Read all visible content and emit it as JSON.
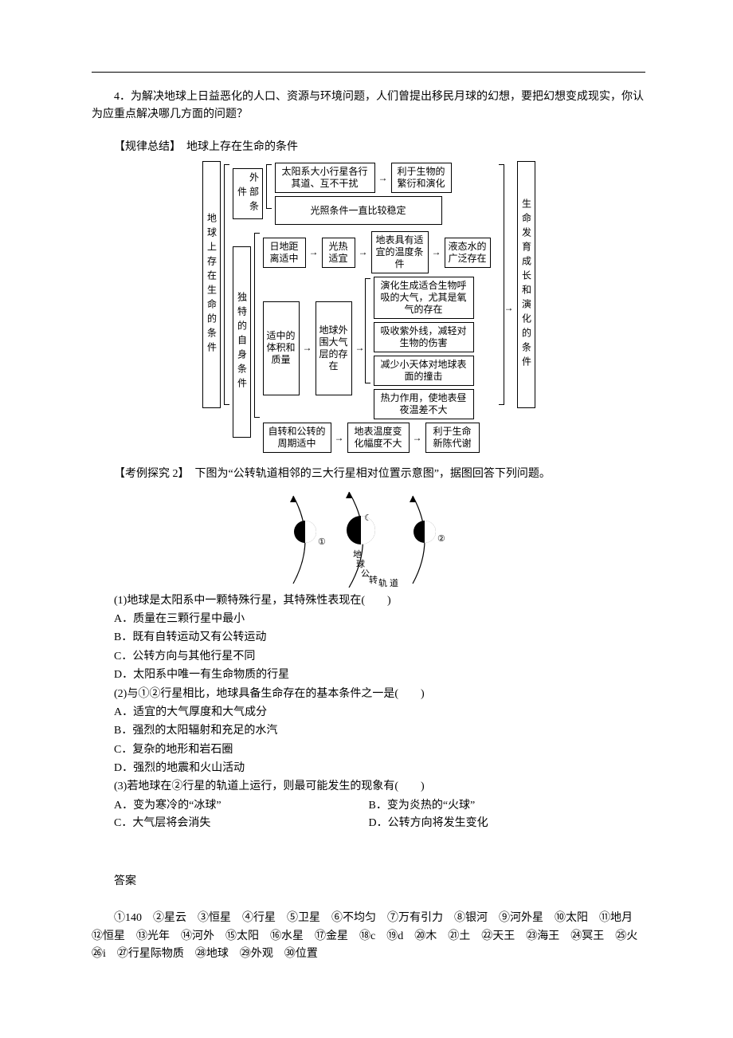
{
  "q4": {
    "label": "4．",
    "text": "为解决地球上日益恶化的人口、资源与环境问题，人们曾提出移民月球的幻想，要把幻想变成现实，你认为应重点解决哪几方面的问题？"
  },
  "rule_summary": {
    "label": "【规律总结】",
    "title": "地球上存在生命的条件"
  },
  "diagram": {
    "main": "地球上存在生命的条件",
    "external_label": "外部条件",
    "ext1": "太阳系大小行星各行其道、互不干扰",
    "ext1r": "利于生物的繁衍和演化",
    "ext2": "光照条件一直比较稳定",
    "self_label": "独特的自身条件",
    "s1a": "日地距离适中",
    "s1b": "光热适宜",
    "s1c": "地表具有适宜的温度条件",
    "s1d": "液态水的广泛存在",
    "s2a": "适中的体积和质量",
    "s2b": "地球外围大气层的存在",
    "s2c1": "演化生成适合生物呼吸的大气，尤其是氧气的存在",
    "s2c2": "吸收紫外线，减轻对生物的伤害",
    "s2c3": "减少小天体对地球表面的撞击",
    "s2c4": "热力作用，使地表昼夜温差不大",
    "s3a": "自转和公转的周期适中",
    "s3b": "地表温度变化幅度不大",
    "s3c": "利于生命新陈代谢",
    "right": "生命发育成长和演化的条件"
  },
  "ex2": {
    "label": "【考例探究 2】",
    "intro": "下图为“公转轨道相邻的三大行星相对位置示意图”，据图回答下列问题。",
    "fig": {
      "label1": "①",
      "earth": "地球",
      "orbit": "公转轨道",
      "label2": "②"
    },
    "q1": {
      "stem": "(1)地球是太阳系中一颗特殊行星，其特殊性表现在(　　)",
      "A": "A．质量在三颗行星中最小",
      "B": "B．既有自转运动又有公转运动",
      "C": "C．公转方向与其他行星不同",
      "D": "D．太阳系中唯一有生命物质的行星"
    },
    "q2": {
      "stem": "(2)与①②行星相比，地球具备生命存在的基本条件之一是(　　)",
      "A": "A．适宜的大气厚度和大气成分",
      "B": "B．强烈的太阳辐射和充足的水汽",
      "C": "C．复杂的地形和岩石圈",
      "D": "D．强烈的地震和火山活动"
    },
    "q3": {
      "stem": "(3)若地球在②行星的轨道上运行，则最可能发生的现象有(　　)",
      "A": "A．变为寒冷的“冰球”",
      "B": "B．变为炎热的“火球”",
      "C": "C．大气层将会消失",
      "D": "D．公转方向将发生变化"
    }
  },
  "answers": {
    "title": "答案",
    "line1": "①140　②星云　③恒星　④行星　⑤卫星　⑥不均匀　⑦万有引力　⑧银河　⑨河外星　⑩太阳　⑪地月　⑫恒星　⑬光年　⑭河外　⑮太阳　⑯水星　⑰金星　⑱c　⑲d　⑳木　㉑土　㉒天王　㉓海王　㉔冥王　㉕火　㉖i　㉗行星际物质　㉘地球　㉙外观　㉚位置"
  }
}
